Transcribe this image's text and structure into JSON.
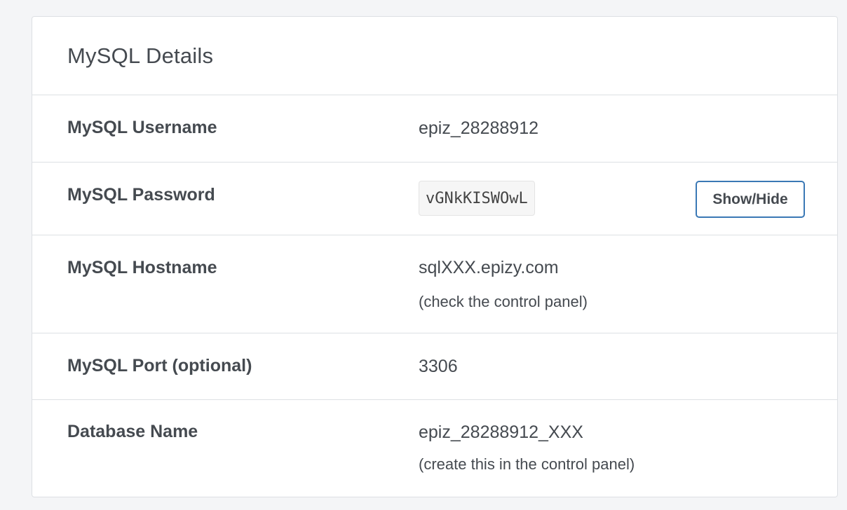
{
  "card": {
    "title": "MySQL Details"
  },
  "rows": [
    {
      "label": "MySQL Username",
      "value": "epiz_28288912"
    },
    {
      "label": "MySQL Password",
      "value": "vGNkKISWOwL",
      "button": "Show/Hide"
    },
    {
      "label": "MySQL Hostname",
      "value": "sqlXXX.epizy.com",
      "note": "(check the control panel)"
    },
    {
      "label": "MySQL Port (optional)",
      "value": "3306"
    },
    {
      "label": "Database Name",
      "value": "epiz_28288912_XXX",
      "note": "(create this in the control panel)"
    }
  ]
}
